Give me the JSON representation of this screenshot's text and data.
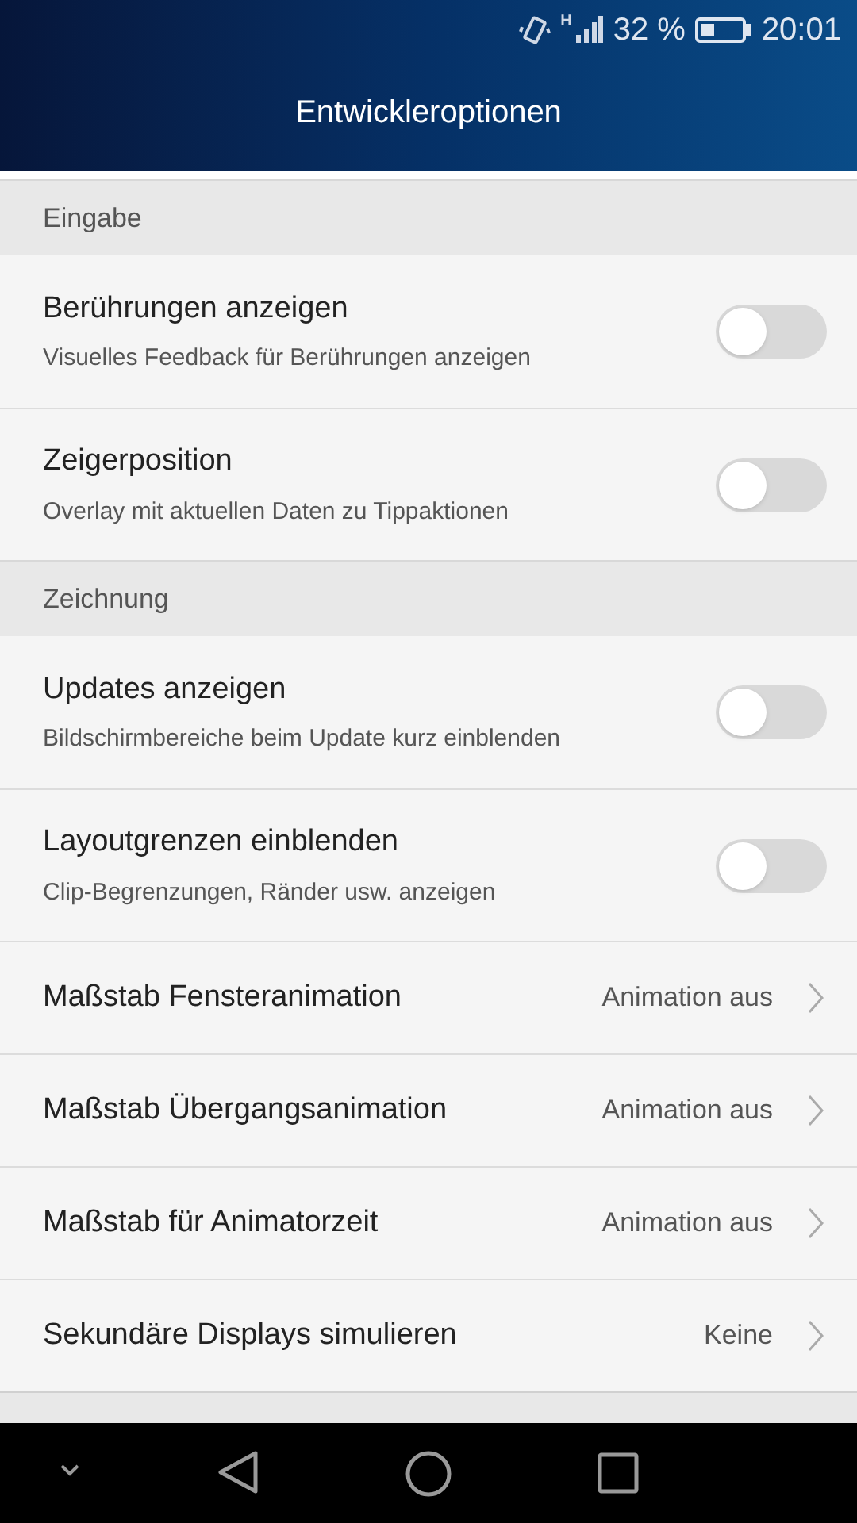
{
  "status_bar": {
    "network": "H",
    "battery_text": "32 %",
    "time": "20:01"
  },
  "title": "Entwickleroptionen",
  "sections": [
    {
      "title": "Eingabe",
      "items": [
        {
          "kind": "toggle",
          "title": "Berührungen anzeigen",
          "subtitle": "Visuelles Feedback für Berührungen anzeigen",
          "on": false
        },
        {
          "kind": "toggle",
          "title": "Zeigerposition",
          "subtitle": "Overlay mit aktuellen Daten zu Tippaktionen",
          "on": false
        }
      ]
    },
    {
      "title": "Zeichnung",
      "items": [
        {
          "kind": "toggle",
          "title": "Updates anzeigen",
          "subtitle": "Bildschirmbereiche beim Update kurz einblenden",
          "on": false
        },
        {
          "kind": "toggle",
          "title": "Layoutgrenzen einblenden",
          "subtitle": "Clip-Begrenzungen, Ränder usw. anzeigen",
          "on": false
        },
        {
          "kind": "value",
          "title": "Maßstab Fensteranimation",
          "value": "Animation aus"
        },
        {
          "kind": "value",
          "title": "Maßstab Übergangsanimation",
          "value": "Animation aus"
        },
        {
          "kind": "value",
          "title": "Maßstab für Animatorzeit",
          "value": "Animation aus"
        },
        {
          "kind": "value",
          "title": "Sekundäre Displays simulieren",
          "value": "Keine"
        }
      ]
    }
  ]
}
